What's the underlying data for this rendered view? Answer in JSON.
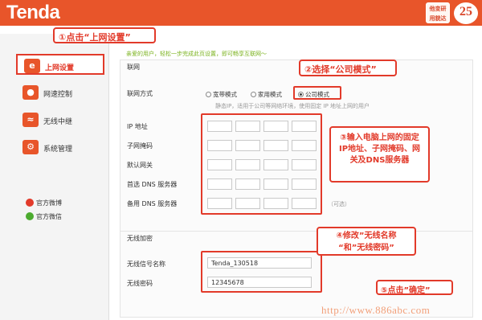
{
  "header": {
    "logo": "Tenda",
    "util_button": [
      "他变研",
      "用貌达"
    ],
    "badge_text": "25"
  },
  "sidebar": {
    "items": [
      {
        "label": "上网设置",
        "icon": "internet-explorer-icon",
        "active": true
      },
      {
        "label": "网速控制",
        "icon": "users-icon",
        "active": false
      },
      {
        "label": "无线中继",
        "icon": "wireless-icon",
        "active": false
      },
      {
        "label": "系统管理",
        "icon": "gear-icon",
        "active": false
      }
    ],
    "social": [
      {
        "label": "官方微博",
        "icon": "weibo-icon"
      },
      {
        "label": "官方微信",
        "icon": "wechat-icon"
      }
    ]
  },
  "main": {
    "intro": "亲爱的用户，轻松一步完成此页设置，即可畅享互联网～",
    "network_panel": {
      "title": "联网",
      "connection_label": "联网方式",
      "modes": [
        {
          "label": "宽带模式",
          "checked": false
        },
        {
          "label": "家用模式",
          "checked": false
        },
        {
          "label": "公司模式",
          "checked": true
        }
      ],
      "mode_hint": "静态IP，适用于公司等网络环境，使用固定 IP 地址上网的用户",
      "fields": [
        {
          "label": "IP 地址"
        },
        {
          "label": "子网掩码"
        },
        {
          "label": "默认网关"
        },
        {
          "label": "首选 DNS 服务器"
        },
        {
          "label": "备用 DNS 服务器",
          "suffix": "（可选）"
        }
      ]
    },
    "wireless_panel": {
      "title": "无线加密",
      "ssid_label": "无线信号名称",
      "ssid_value": "Tenda_130518",
      "password_label": "无线密码",
      "password_value": "12345678"
    }
  },
  "callouts": {
    "step1": "①点击“上网设置”",
    "step2": "②选择“公司模式”",
    "step3": "③输入电脑上网的固定IP地址、子网掩码、网关及DNS服务器",
    "step4_line1": "④修改”无线名称",
    "step4_line2": "“和”无线密码”",
    "step5": "⑤点击”确定”"
  },
  "watermark": "http://www.886abc.com",
  "colors": {
    "brand_orange": "#e8552a",
    "annotation_red": "#e23a2a",
    "intro_green": "#7ab21c"
  }
}
